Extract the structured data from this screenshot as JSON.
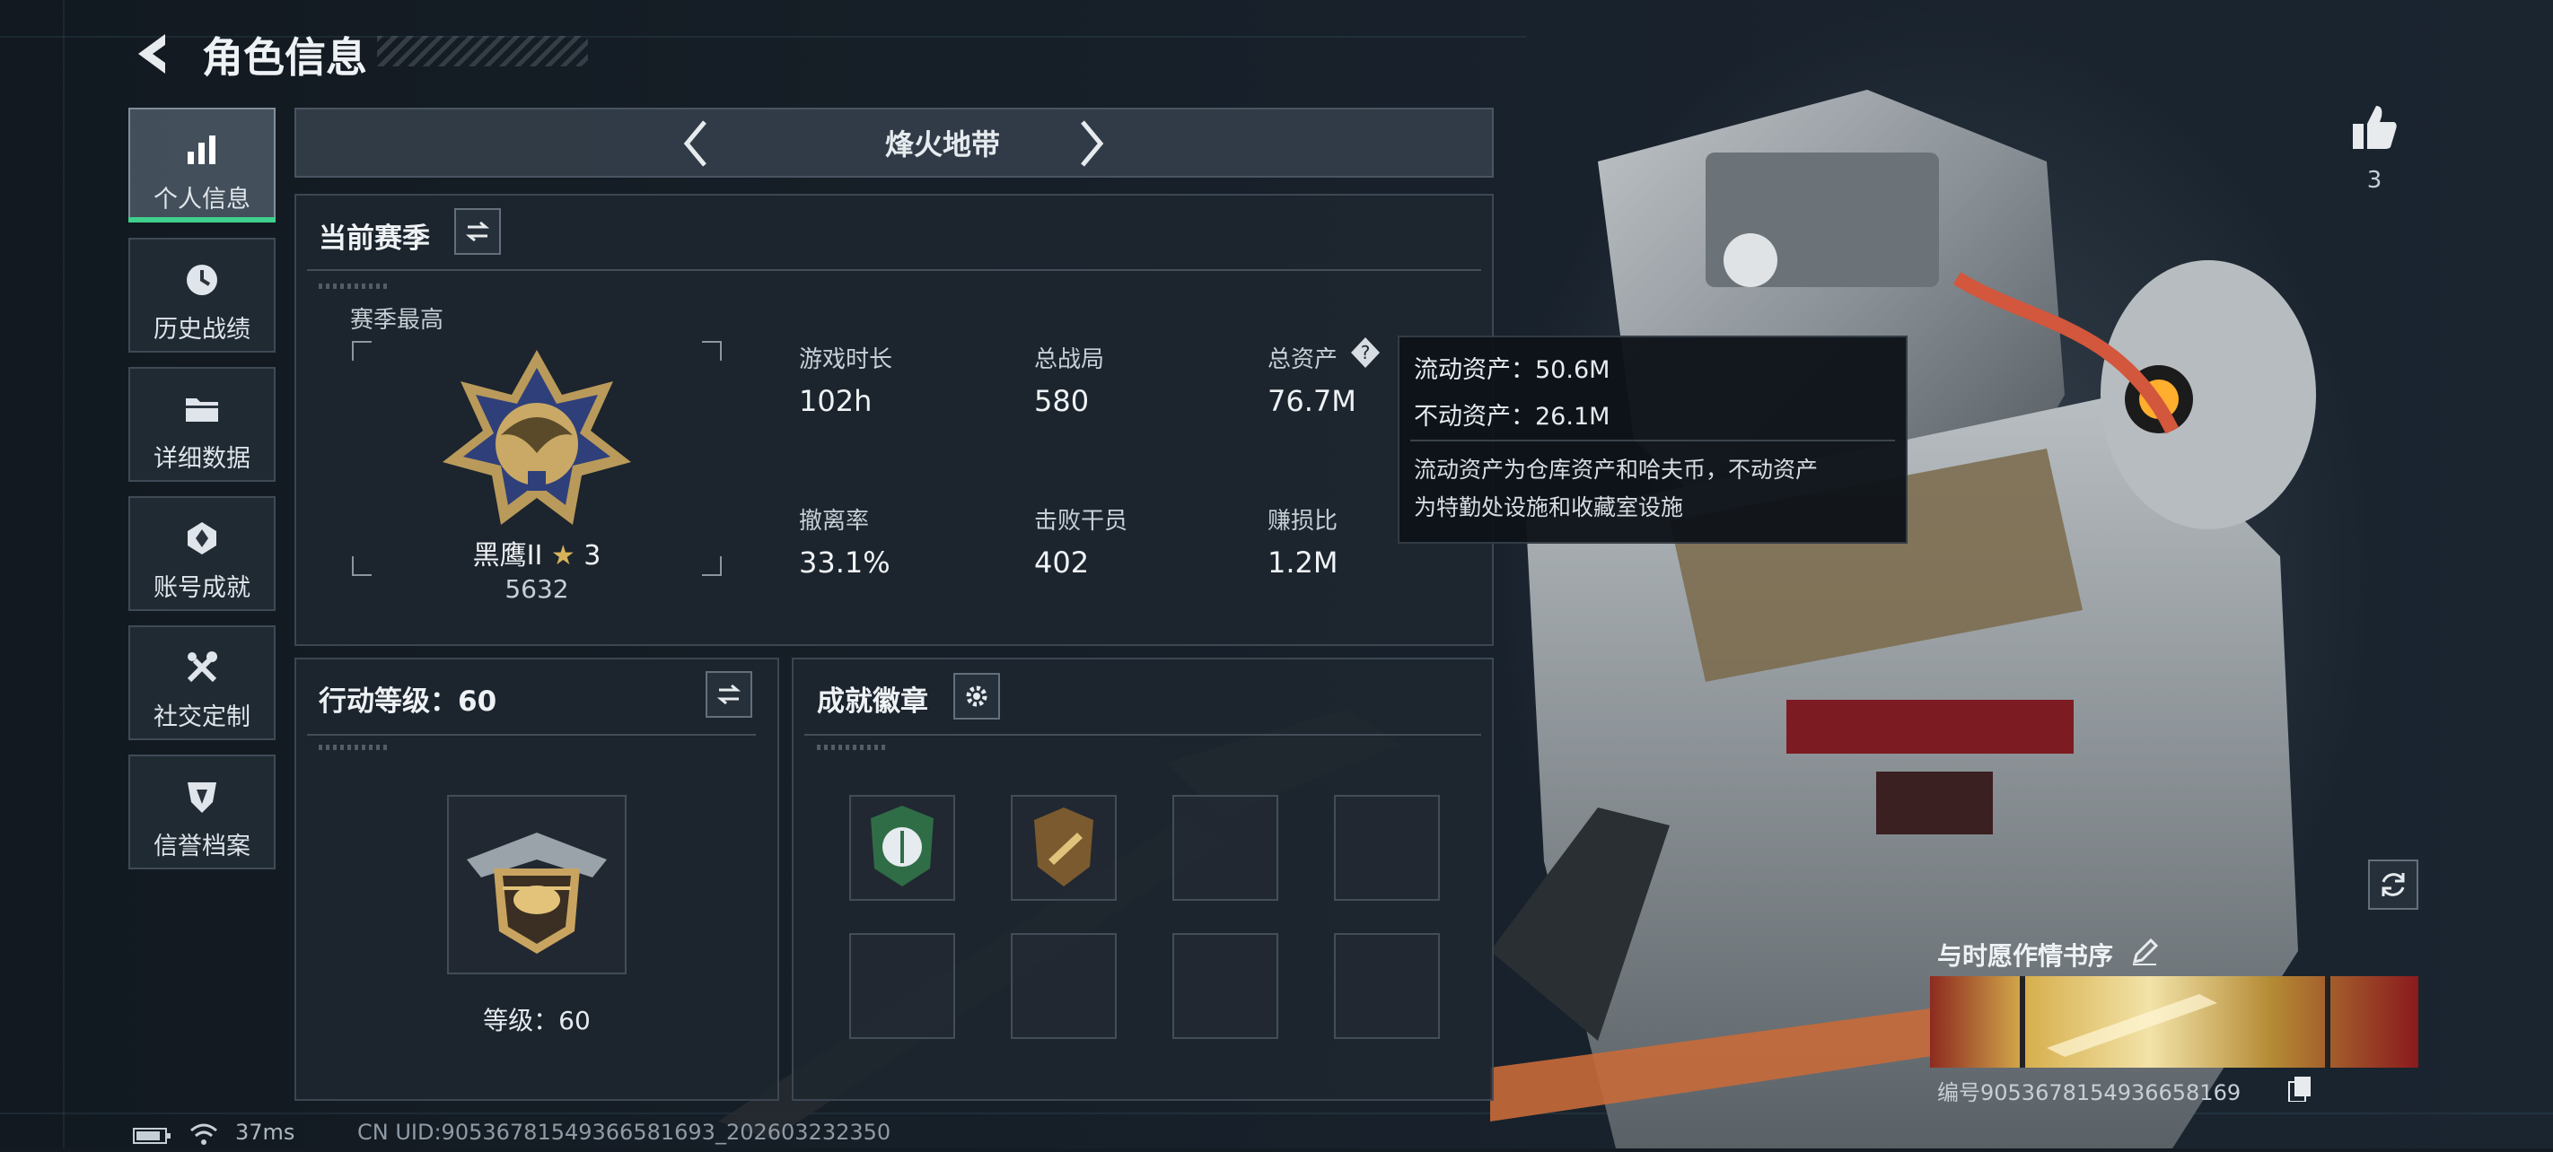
{
  "header": {
    "title": "角色信息"
  },
  "sidebar": {
    "items": [
      {
        "label": "个人信息",
        "icon": "bar-chart-icon",
        "active": true
      },
      {
        "label": "历史战绩",
        "icon": "clock-icon"
      },
      {
        "label": "详细数据",
        "icon": "folder-icon"
      },
      {
        "label": "账号成就",
        "icon": "achievement-icon"
      },
      {
        "label": "社交定制",
        "icon": "tools-icon"
      },
      {
        "label": "信誉档案",
        "icon": "shield-icon"
      }
    ]
  },
  "mode_selector": {
    "label": "烽火地带"
  },
  "season": {
    "title": "当前赛季",
    "best_label": "赛季最高",
    "rank_name": "黑鹰II",
    "rank_stars": "3",
    "rank_score": "5632",
    "stats": [
      {
        "label": "游戏时长",
        "value": "102h"
      },
      {
        "label": "总战局",
        "value": "580"
      },
      {
        "label": "总资产",
        "value": "76.7M"
      },
      {
        "label": "撤离率",
        "value": "33.1%"
      },
      {
        "label": "击败干员",
        "value": "402"
      },
      {
        "label": "赚损比",
        "value": "1.2M"
      }
    ]
  },
  "tooltip": {
    "liquid": "流动资产：50.6M",
    "fixed": "不动资产：26.1M",
    "desc_line1": "流动资产为仓库资产和哈夫币，不动资产",
    "desc_line2": "为特勤处设施和收藏室设施"
  },
  "action_level": {
    "title": "行动等级：60",
    "level_text": "等级：60"
  },
  "badges": {
    "title": "成就徽章"
  },
  "likes": {
    "count": "3"
  },
  "card": {
    "title": "与时愿作情书序",
    "id_text": "编号9053678154936658169"
  },
  "status_bar": {
    "ping": "37ms",
    "uid": "CN UID:90536781549366581693_202603232350"
  },
  "colors": {
    "accent": "#3fd08d",
    "tooltip_bg": "#10151b",
    "panel_bg": "#1e262f"
  }
}
